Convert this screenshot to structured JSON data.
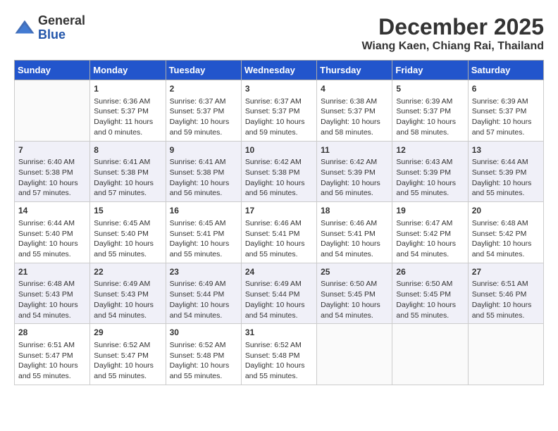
{
  "header": {
    "logo_general": "General",
    "logo_blue": "Blue",
    "month": "December 2025",
    "location": "Wiang Kaen, Chiang Rai, Thailand"
  },
  "days_of_week": [
    "Sunday",
    "Monday",
    "Tuesday",
    "Wednesday",
    "Thursday",
    "Friday",
    "Saturday"
  ],
  "weeks": [
    [
      {
        "day": "",
        "info": ""
      },
      {
        "day": "1",
        "info": "Sunrise: 6:36 AM\nSunset: 5:37 PM\nDaylight: 11 hours\nand 0 minutes."
      },
      {
        "day": "2",
        "info": "Sunrise: 6:37 AM\nSunset: 5:37 PM\nDaylight: 10 hours\nand 59 minutes."
      },
      {
        "day": "3",
        "info": "Sunrise: 6:37 AM\nSunset: 5:37 PM\nDaylight: 10 hours\nand 59 minutes."
      },
      {
        "day": "4",
        "info": "Sunrise: 6:38 AM\nSunset: 5:37 PM\nDaylight: 10 hours\nand 58 minutes."
      },
      {
        "day": "5",
        "info": "Sunrise: 6:39 AM\nSunset: 5:37 PM\nDaylight: 10 hours\nand 58 minutes."
      },
      {
        "day": "6",
        "info": "Sunrise: 6:39 AM\nSunset: 5:37 PM\nDaylight: 10 hours\nand 57 minutes."
      }
    ],
    [
      {
        "day": "7",
        "info": "Sunrise: 6:40 AM\nSunset: 5:38 PM\nDaylight: 10 hours\nand 57 minutes."
      },
      {
        "day": "8",
        "info": "Sunrise: 6:41 AM\nSunset: 5:38 PM\nDaylight: 10 hours\nand 57 minutes."
      },
      {
        "day": "9",
        "info": "Sunrise: 6:41 AM\nSunset: 5:38 PM\nDaylight: 10 hours\nand 56 minutes."
      },
      {
        "day": "10",
        "info": "Sunrise: 6:42 AM\nSunset: 5:38 PM\nDaylight: 10 hours\nand 56 minutes."
      },
      {
        "day": "11",
        "info": "Sunrise: 6:42 AM\nSunset: 5:39 PM\nDaylight: 10 hours\nand 56 minutes."
      },
      {
        "day": "12",
        "info": "Sunrise: 6:43 AM\nSunset: 5:39 PM\nDaylight: 10 hours\nand 55 minutes."
      },
      {
        "day": "13",
        "info": "Sunrise: 6:44 AM\nSunset: 5:39 PM\nDaylight: 10 hours\nand 55 minutes."
      }
    ],
    [
      {
        "day": "14",
        "info": "Sunrise: 6:44 AM\nSunset: 5:40 PM\nDaylight: 10 hours\nand 55 minutes."
      },
      {
        "day": "15",
        "info": "Sunrise: 6:45 AM\nSunset: 5:40 PM\nDaylight: 10 hours\nand 55 minutes."
      },
      {
        "day": "16",
        "info": "Sunrise: 6:45 AM\nSunset: 5:41 PM\nDaylight: 10 hours\nand 55 minutes."
      },
      {
        "day": "17",
        "info": "Sunrise: 6:46 AM\nSunset: 5:41 PM\nDaylight: 10 hours\nand 55 minutes."
      },
      {
        "day": "18",
        "info": "Sunrise: 6:46 AM\nSunset: 5:41 PM\nDaylight: 10 hours\nand 54 minutes."
      },
      {
        "day": "19",
        "info": "Sunrise: 6:47 AM\nSunset: 5:42 PM\nDaylight: 10 hours\nand 54 minutes."
      },
      {
        "day": "20",
        "info": "Sunrise: 6:48 AM\nSunset: 5:42 PM\nDaylight: 10 hours\nand 54 minutes."
      }
    ],
    [
      {
        "day": "21",
        "info": "Sunrise: 6:48 AM\nSunset: 5:43 PM\nDaylight: 10 hours\nand 54 minutes."
      },
      {
        "day": "22",
        "info": "Sunrise: 6:49 AM\nSunset: 5:43 PM\nDaylight: 10 hours\nand 54 minutes."
      },
      {
        "day": "23",
        "info": "Sunrise: 6:49 AM\nSunset: 5:44 PM\nDaylight: 10 hours\nand 54 minutes."
      },
      {
        "day": "24",
        "info": "Sunrise: 6:49 AM\nSunset: 5:44 PM\nDaylight: 10 hours\nand 54 minutes."
      },
      {
        "day": "25",
        "info": "Sunrise: 6:50 AM\nSunset: 5:45 PM\nDaylight: 10 hours\nand 54 minutes."
      },
      {
        "day": "26",
        "info": "Sunrise: 6:50 AM\nSunset: 5:45 PM\nDaylight: 10 hours\nand 55 minutes."
      },
      {
        "day": "27",
        "info": "Sunrise: 6:51 AM\nSunset: 5:46 PM\nDaylight: 10 hours\nand 55 minutes."
      }
    ],
    [
      {
        "day": "28",
        "info": "Sunrise: 6:51 AM\nSunset: 5:47 PM\nDaylight: 10 hours\nand 55 minutes."
      },
      {
        "day": "29",
        "info": "Sunrise: 6:52 AM\nSunset: 5:47 PM\nDaylight: 10 hours\nand 55 minutes."
      },
      {
        "day": "30",
        "info": "Sunrise: 6:52 AM\nSunset: 5:48 PM\nDaylight: 10 hours\nand 55 minutes."
      },
      {
        "day": "31",
        "info": "Sunrise: 6:52 AM\nSunset: 5:48 PM\nDaylight: 10 hours\nand 55 minutes."
      },
      {
        "day": "",
        "info": ""
      },
      {
        "day": "",
        "info": ""
      },
      {
        "day": "",
        "info": ""
      }
    ]
  ]
}
